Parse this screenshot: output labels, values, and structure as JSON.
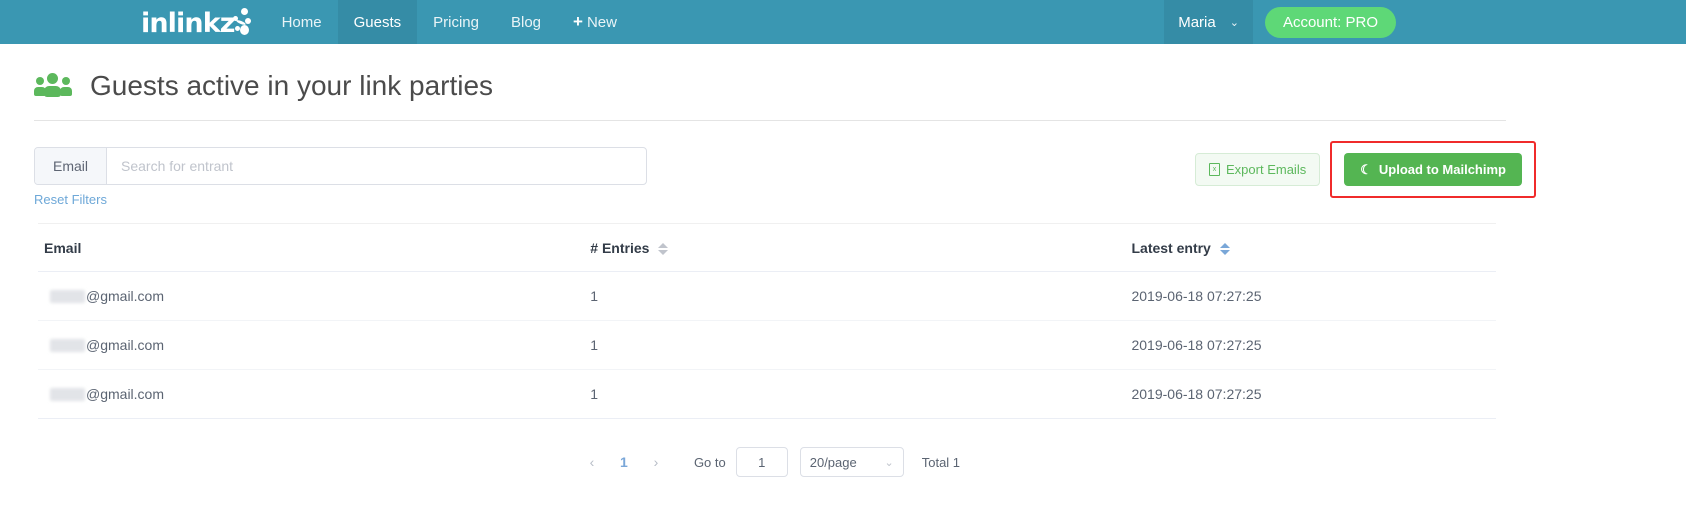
{
  "navbar": {
    "brand": "inlinkz",
    "brand_icon": "inlinkz-dot-logo",
    "items": [
      {
        "label": "Home",
        "active": false
      },
      {
        "label": "Guests",
        "active": true
      },
      {
        "label": "Pricing",
        "active": false
      },
      {
        "label": "Blog",
        "active": false
      }
    ],
    "new_label": "New",
    "new_plus": "+",
    "user": "Maria",
    "user_caret": "⌄",
    "account_label": "Account: PRO",
    "bg_color": "#3a97b2",
    "accent_green": "#5ed877"
  },
  "header": {
    "title": "Guests active in your link parties",
    "icon": "guests-group-icon"
  },
  "toolbar": {
    "search_addon_label": "Email",
    "search_value": "",
    "search_placeholder": "Search for entrant",
    "export_label": "Export Emails",
    "export_icon": "xls-file-icon",
    "export_icon_glyph": "x",
    "mailchimp_label": "Upload to Mailchimp",
    "mailchimp_icon": "mailchimp-chimp-icon",
    "mailchimp_icon_glyph": "☾",
    "highlight_color": "#f02b2b",
    "reset_label": "Reset Filters"
  },
  "table": {
    "columns": [
      {
        "label": "Email",
        "sortable": false
      },
      {
        "label": "# Entries",
        "sortable": true,
        "sort_active": false
      },
      {
        "label": "Latest entry",
        "sortable": true,
        "sort_active": true
      }
    ],
    "rows": [
      {
        "email_redacted": true,
        "email_suffix": "@gmail.com",
        "entries": "1",
        "latest": "2019-06-18 07:27:25"
      },
      {
        "email_redacted": true,
        "email_suffix": "@gmail.com",
        "entries": "1",
        "latest": "2019-06-18 07:27:25"
      },
      {
        "email_redacted": true,
        "email_suffix": "@gmail.com",
        "entries": "1",
        "latest": "2019-06-18 07:27:25"
      }
    ]
  },
  "pagination": {
    "prev_icon": "‹",
    "next_icon": "›",
    "current_page": "1",
    "goto_label": "Go to",
    "goto_value": "1",
    "page_size": "20/page",
    "page_size_caret": "⌄",
    "total_text": "Total 1"
  }
}
